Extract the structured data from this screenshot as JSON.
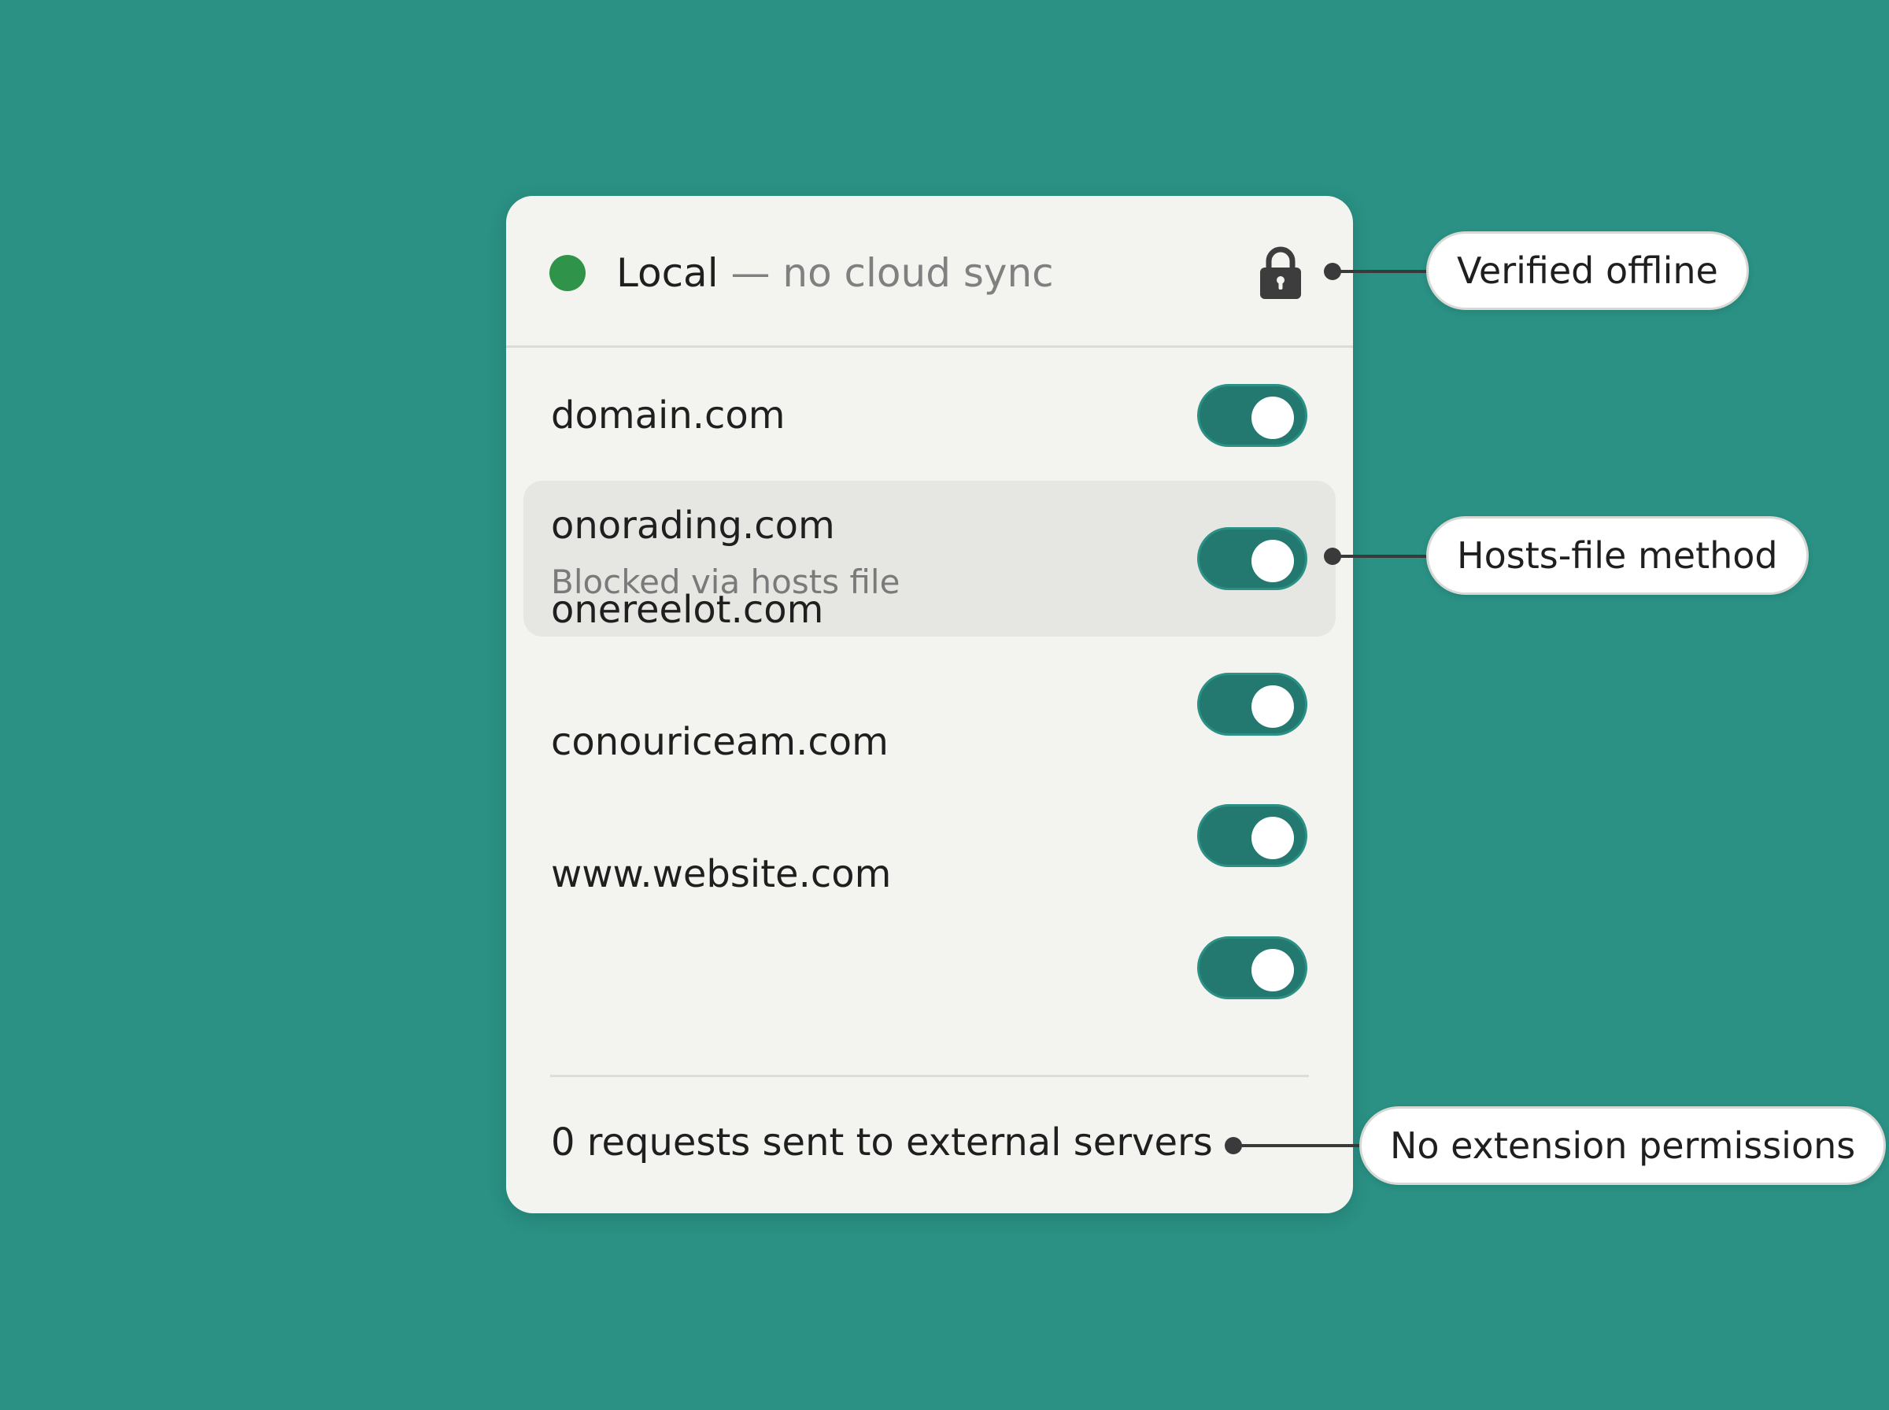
{
  "colors": {
    "background": "#2a9184",
    "panel": "#f3f3ef",
    "status_dot": "#2f9449",
    "toggle_on": "#23796f",
    "toggle_border": "#2a9184",
    "lock": "#3d3d3d"
  },
  "header": {
    "title": "Local",
    "subtitle": " — no cloud sync",
    "status_icon": "green-status-dot",
    "lock_icon": "lock-icon"
  },
  "domains": [
    {
      "name": "domain.com",
      "enabled": true
    },
    {
      "name": "onorading.com",
      "sub": "Blocked via hosts file",
      "enabled": true,
      "highlighted": true
    },
    {
      "name": "onereelot.com",
      "enabled": true
    },
    {
      "name": "conouriceam.com",
      "enabled": true
    },
    {
      "name": "www.website.com",
      "enabled": true
    }
  ],
  "footer": {
    "text": "0 requests sent to external servers"
  },
  "callouts": {
    "verified": "Verified offline",
    "hosts": "Hosts-file method",
    "permissions": "No extension permissions"
  }
}
